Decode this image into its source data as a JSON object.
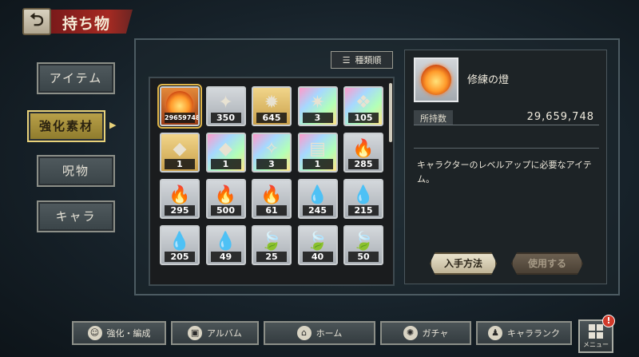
{
  "header": {
    "back_glyph": "⮌",
    "title": "持ち物"
  },
  "tabs": [
    {
      "label": "アイテム",
      "active": false
    },
    {
      "label": "強化素材",
      "active": true
    },
    {
      "label": "呪物",
      "active": false
    },
    {
      "label": "キャラ",
      "active": false
    }
  ],
  "sort": {
    "icon": "sort-icon",
    "label": "種類順"
  },
  "items": [
    {
      "qty": "29659748",
      "bg": "orange",
      "glyph": "",
      "icon": "flame-orb-icon",
      "selected": true
    },
    {
      "qty": "350",
      "bg": "silver",
      "glyph": "✦",
      "icon": "crystal-shard-icon"
    },
    {
      "qty": "645",
      "bg": "gold",
      "glyph": "✹",
      "icon": "crystal-cluster-icon"
    },
    {
      "qty": "3",
      "bg": "rainbow",
      "glyph": "✷",
      "icon": "rainbow-crystal-icon"
    },
    {
      "qty": "105",
      "bg": "rainbow",
      "glyph": "❖",
      "icon": "rainbow-shard-icon"
    },
    {
      "qty": "1",
      "bg": "gold",
      "glyph": "◆",
      "icon": "gold-gem-icon"
    },
    {
      "qty": "1",
      "bg": "rainbow",
      "glyph": "◆",
      "icon": "rainbow-gem-icon"
    },
    {
      "qty": "3",
      "bg": "rainbow",
      "glyph": "✧",
      "icon": "rainbow-sparkle-icon"
    },
    {
      "qty": "1",
      "bg": "rainbow",
      "glyph": "▤",
      "icon": "book-icon"
    },
    {
      "qty": "285",
      "bg": "silver",
      "glyph": "🔥",
      "icon": "red-flame-icon"
    },
    {
      "qty": "295",
      "bg": "silver",
      "glyph": "🔥",
      "icon": "red-flame-icon"
    },
    {
      "qty": "500",
      "bg": "silver",
      "glyph": "🔥",
      "icon": "red-flame-icon"
    },
    {
      "qty": "61",
      "bg": "silver",
      "glyph": "🔥",
      "icon": "red-flame-icon"
    },
    {
      "qty": "245",
      "bg": "silver",
      "glyph": "💧",
      "icon": "blue-flame-icon"
    },
    {
      "qty": "215",
      "bg": "silver",
      "glyph": "💧",
      "icon": "blue-flame-icon"
    },
    {
      "qty": "205",
      "bg": "silver",
      "glyph": "💧",
      "icon": "blue-flame-icon"
    },
    {
      "qty": "49",
      "bg": "silver",
      "glyph": "💧",
      "icon": "blue-flame-icon"
    },
    {
      "qty": "25",
      "bg": "silver",
      "glyph": "🍃",
      "icon": "green-flame-icon"
    },
    {
      "qty": "40",
      "bg": "silver",
      "glyph": "🍃",
      "icon": "green-flame-icon"
    },
    {
      "qty": "50",
      "bg": "silver",
      "glyph": "🍃",
      "icon": "green-flame-icon"
    }
  ],
  "detail": {
    "name": "修練の燈",
    "own_label": "所持数",
    "own_value": "29,659,748",
    "description": "キャラクターのレベルアップに必要なアイテム。",
    "obtain_label": "入手方法",
    "use_label": "使用する"
  },
  "nav": [
    {
      "label": "強化・編成",
      "icon": "party-icon",
      "glyph": "☺"
    },
    {
      "label": "アルバム",
      "icon": "album-icon",
      "glyph": "▣"
    },
    {
      "label": "ホーム",
      "icon": "home-icon",
      "glyph": "⌂"
    },
    {
      "label": "ガチャ",
      "icon": "gacha-icon",
      "glyph": "✺"
    },
    {
      "label": "キャラランク",
      "icon": "rank-icon",
      "glyph": "♟"
    }
  ],
  "menu": {
    "label": "メニュー",
    "badge": "!"
  },
  "colors": {
    "accent_gold": "#e8d27a",
    "title_red": "#a62a22",
    "alert_red": "#d23a2a"
  }
}
